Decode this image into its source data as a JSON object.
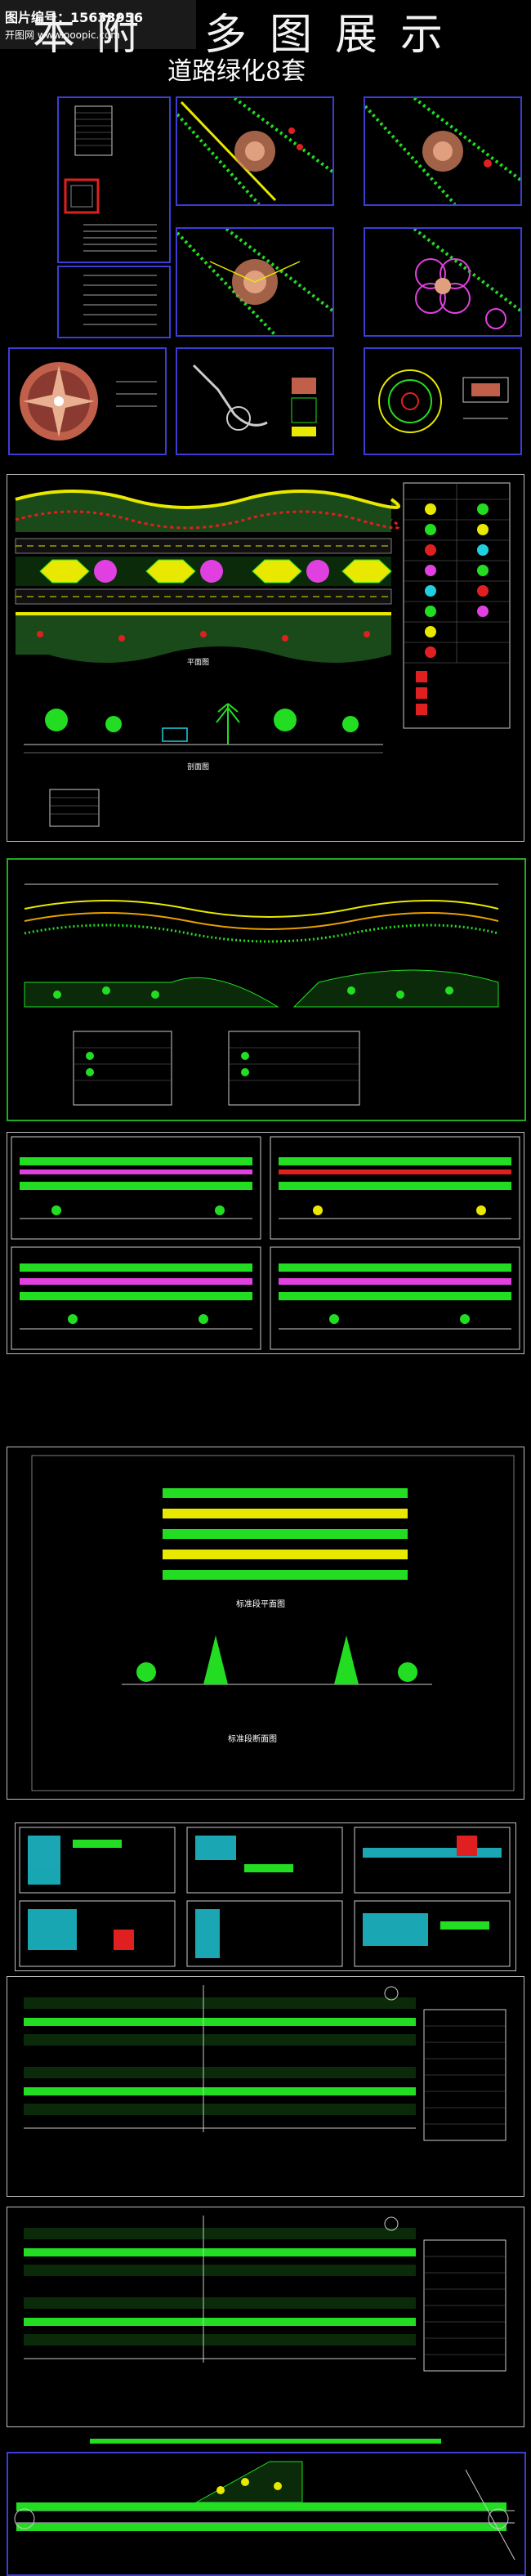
{
  "header": {
    "badge_line1": "图片编号：15633956",
    "badge_line2": "开图网 www.ooopic.com",
    "title_chars": [
      "本",
      "附",
      "多",
      "图",
      "展",
      "示"
    ],
    "subtitle": "道路绿化8套"
  },
  "panels": {
    "plan_labels": [
      "平面图",
      "剖面图"
    ],
    "section_title_a": "标准段平面图",
    "section_title_b": "标准段断面图"
  },
  "colors": {
    "panel_border": "#3d3dd6",
    "plant_green": "#22dd22",
    "plant_yellow": "#e8e800",
    "plant_red": "#e02020",
    "plant_magenta": "#e040e0",
    "plant_cyan": "#20d0e0"
  }
}
